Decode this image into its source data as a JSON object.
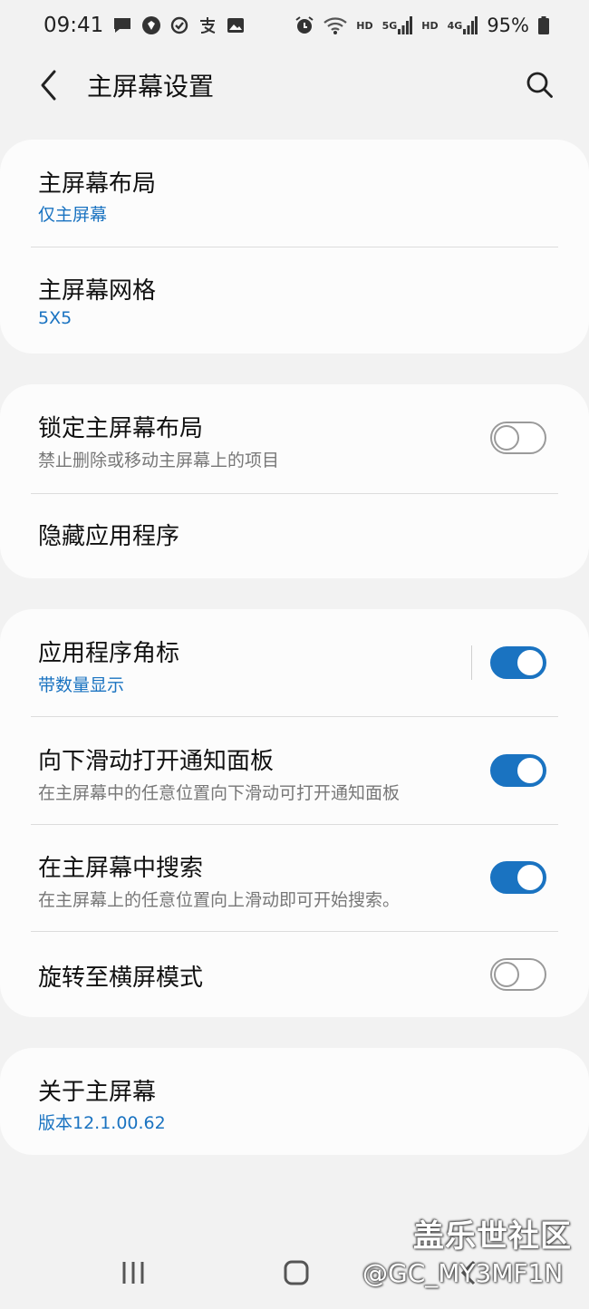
{
  "status_bar": {
    "time": "09:41",
    "battery": "95%",
    "left_icons": [
      "chat-icon",
      "shield-icon",
      "check-circle-icon",
      "alipay-icon",
      "image-icon"
    ],
    "net_tags": [
      "HD",
      "5G",
      "HD",
      "4G"
    ]
  },
  "header": {
    "title": "主屏幕设置"
  },
  "groups": {
    "layout": {
      "layout_title": "主屏幕布局",
      "layout_value": "仅主屏幕",
      "grid_title": "主屏幕网格",
      "grid_value": "5X5"
    },
    "lock": {
      "lock_title": "锁定主屏幕布局",
      "lock_desc": "禁止删除或移动主屏幕上的项目",
      "lock_on": false,
      "hide_title": "隐藏应用程序"
    },
    "badges": {
      "badge_title": "应用程序角标",
      "badge_value": "带数量显示",
      "badge_on": true,
      "swipe_title": "向下滑动打开通知面板",
      "swipe_desc": "在主屏幕中的任意位置向下滑动可打开通知面板",
      "swipe_on": true,
      "search_title": "在主屏幕中搜索",
      "search_desc": "在主屏幕上的任意位置向上滑动即可开始搜索。",
      "search_on": true,
      "rotate_title": "旋转至横屏模式",
      "rotate_on": false
    },
    "about": {
      "about_title": "关于主屏幕",
      "about_version": "版本12.1.00.62"
    }
  },
  "watermark": {
    "brand": "盖乐世社区",
    "handle": "@GC_MY3MF1N"
  },
  "colors": {
    "accent": "#1a73c1",
    "background": "#f2f2f2",
    "card": "#fcfcfc"
  }
}
